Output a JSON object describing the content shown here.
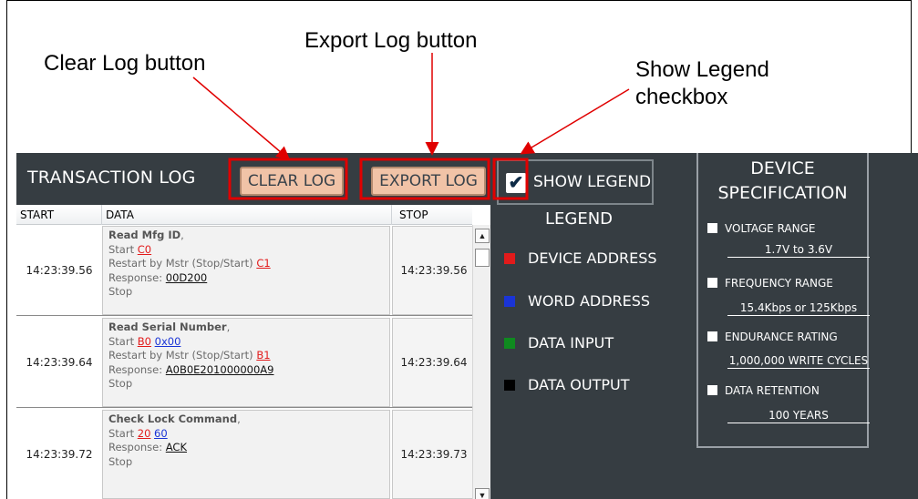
{
  "callouts": {
    "clear_log": "Clear Log button",
    "export_log": "Export Log button",
    "show_legend": "Show Legend\ncheckbox"
  },
  "header": {
    "title": "TRANSACTION LOG",
    "clear_label": "CLEAR LOG",
    "export_label": "EXPORT LOG",
    "show_legend_label": "SHOW LEGEND",
    "show_legend_checked": "✔"
  },
  "table": {
    "columns": [
      "START",
      "DATA",
      "STOP"
    ],
    "rows": [
      {
        "start": "14:23:39.56",
        "stop": "14:23:39.56",
        "cmd": "Read Mfg ID",
        "line2_prefix": "Start ",
        "line2_a": "C0",
        "line2_b": "",
        "line3_prefix": "Restart by Mstr (Stop/Start) ",
        "line3_a": "C1",
        "resp_prefix": "Response: ",
        "resp": "00D200",
        "end": "Stop"
      },
      {
        "start": "14:23:39.64",
        "stop": "14:23:39.64",
        "cmd": "Read Serial Number",
        "line2_prefix": "Start ",
        "line2_a": "B0",
        "line2_b": "0x00",
        "line3_prefix": "Restart by Mstr (Stop/Start) ",
        "line3_a": "B1",
        "resp_prefix": "Response: ",
        "resp": "A0B0E201000000A9",
        "end": "Stop"
      },
      {
        "start": "14:23:39.72",
        "stop": "14:23:39.73",
        "cmd": "Check Lock Command",
        "line2_prefix": "Start ",
        "line2_a": "20",
        "line2_b": "60",
        "resp_prefix": "Response: ",
        "resp": "ACK",
        "end": "Stop"
      }
    ],
    "scroll_up": "▲",
    "scroll_down": "▼"
  },
  "legend": {
    "title": "LEGEND",
    "items": [
      {
        "label": "DEVICE ADDRESS",
        "color": "#e21b1b"
      },
      {
        "label": "WORD ADDRESS",
        "color": "#1a34d6"
      },
      {
        "label": "DATA INPUT",
        "color": "#0f8a1f"
      },
      {
        "label": "DATA OUTPUT",
        "color": "#000000"
      }
    ]
  },
  "spec": {
    "title": "DEVICE\nSPECIFICATION",
    "items": [
      {
        "label": "VOLTAGE RANGE",
        "value": "1.7V to 3.6V"
      },
      {
        "label": "FREQUENCY RANGE",
        "value": "15.4Kbps or 125Kbps"
      },
      {
        "label": "ENDURANCE RATING",
        "value": "1,000,000 WRITE CYCLES"
      },
      {
        "label": "DATA RETENTION",
        "value": "100 YEARS"
      }
    ]
  },
  "colors": {
    "panel_bg": "#363d42",
    "button_bg": "#f1c3a7",
    "callout_red": "#e00000"
  }
}
